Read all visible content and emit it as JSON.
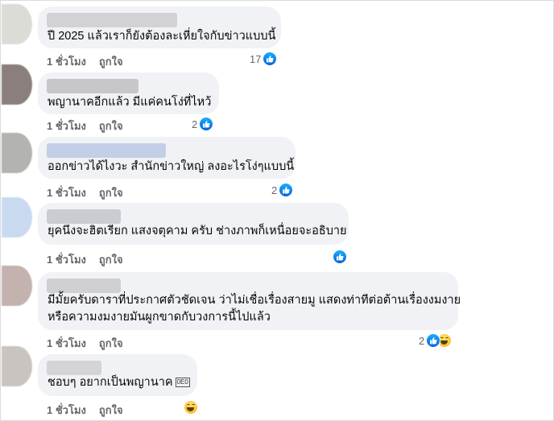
{
  "comments": [
    {
      "text_lines": [
        "ปี 2025 แล้วเราก็ยังต้องละเหี่ยใจกับข่าวแบบนี้"
      ],
      "time": "1 ชั่วโมง",
      "like": "ถูกใจ",
      "reaction_count": "17",
      "reactions": [
        "like"
      ],
      "avatar_color": "#dcdcd6",
      "name_color": "#d2d2d6"
    },
    {
      "text_lines": [
        "พญานาคอีกแล้ว มีแค่คนโง่ที่ไหว้"
      ],
      "time": "1 ชั่วโมง",
      "like": "ถูกใจ",
      "reaction_count": "2",
      "reactions": [
        "like"
      ],
      "avatar_color": "#8a7f7c",
      "name_color": "#c7c7cb"
    },
    {
      "text_lines": [
        "ออกข่าวได้ไงวะ สำนักข่าวใหญ่ ลงอะไรโง่ๆแบบนี้"
      ],
      "time": "1 ชั่วโมง",
      "like": "ถูกใจ",
      "reaction_count": "2",
      "reactions": [
        "like"
      ],
      "avatar_color": "#b3b3b0",
      "name_color": "#c3cfe6"
    },
    {
      "text_lines": [
        "ยุคนึงจะฮิตเรียก แสงจตุคาม ครับ ช่างภาพก็เหนื่อยจะอธิบาย"
      ],
      "time": "1 ชั่วโมง",
      "like": "ถูกใจ",
      "reaction_count": "",
      "reactions": [
        "like"
      ],
      "avatar_color": "#c9daf0",
      "name_color": "#cbcbd2"
    },
    {
      "text_lines": [
        "มีมั้ยครับดาราที่ประกาศตัวชัดเจน ว่าไม่เชื่อเรื่องสายมู แสดงท่าทีต่อต้านเรื่องงมงาย",
        "หรือความงมงายมันผูกขาดกับวงการนี้ไปแล้ว"
      ],
      "time": "1 ชั่วโมง",
      "like": "ถูกใจ",
      "reaction_count": "2",
      "reactions": [
        "like",
        "haha"
      ],
      "avatar_color": "#c4b2ae",
      "name_color": "#cfcfd4"
    },
    {
      "text_lines": [
        "ชอบๆ อยากเป็นพญานาค"
      ],
      "inline_emoji": "0E0",
      "time": "1 ชั่วโมง",
      "like": "ถูกใจ",
      "reaction_count": "",
      "reactions": [
        "haha"
      ],
      "avatar_color": "#c9c4bf",
      "name_color": "#d4d4d8"
    }
  ]
}
